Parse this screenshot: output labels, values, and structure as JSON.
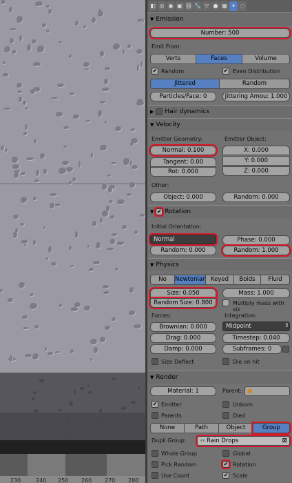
{
  "emission": {
    "title": "Emission",
    "number": "Number: 500",
    "emit_from_label": "Emit From:",
    "emit_from": [
      "Verts",
      "Faces",
      "Volume"
    ],
    "random": "Random",
    "even_distribution": "Even Distribution",
    "jitter_modes": [
      "Jittered",
      "Random"
    ],
    "particles_face": "Particles/Face: 0",
    "jittering_amount": "Jittering Amou: 1.000"
  },
  "hair": {
    "title": "Hair dynamics"
  },
  "velocity": {
    "title": "Velocity",
    "emitter_geometry_label": "Emitter Geometry:",
    "emitter_object_label": "Emitter Object:",
    "normal": "Normal: 0.100",
    "tangent": "Tangent: 0.00",
    "rot": "Rot: 0.000",
    "x": "X: 0.000",
    "y": "Y: 0.000",
    "z": "Z: 0.000",
    "other_label": "Other:",
    "object": "Object: 0.000",
    "random": "Random: 0.000"
  },
  "rotation": {
    "title": "Rotation",
    "initial_orientation_label": "Initial Orientation:",
    "orientation": "Normal",
    "random": "Random: 0.000",
    "phase": "Phase: 0.000",
    "phase_random": "Random: 1.000"
  },
  "physics": {
    "title": "Physics",
    "modes": [
      "No",
      "Newtonian",
      "Keyed",
      "Boids",
      "Fluid"
    ],
    "size": "Size: 0.050",
    "random_size": "Random Size: 0.800",
    "mass": "Mass: 1.000",
    "multiply_mass": "Multiply mass with siz",
    "forces_label": "Forces:",
    "integration_label": "Integration:",
    "brownian": "Brownian: 0.000",
    "drag": "Drag: 0.000",
    "damp": "Damp: 0.000",
    "integrator": "Midpoint",
    "timestep": "Timestep: 0.040",
    "subframes": "Subframes: 0",
    "size_deflect": "Size Deflect",
    "die_on_hit": "Die on hit"
  },
  "render": {
    "title": "Render",
    "material": "Material: 1",
    "parent": "Parent:",
    "emitter": "Emitter",
    "unborn": "Unborn",
    "parents": "Parents",
    "died": "Died",
    "types": [
      "None",
      "Path",
      "Object",
      "Group"
    ],
    "dupli_group_label": "Dupli Group:",
    "dupli_group": "Rain Drops",
    "whole_group": "Whole Group",
    "global": "Global",
    "pick_random": "Pick Random",
    "rotation": "Rotation",
    "use_count": "Use Count",
    "scale": "Scale"
  },
  "ruler": {
    "ticks": [
      "230",
      "240",
      "250",
      "260",
      "270",
      "280"
    ]
  },
  "colors": {
    "accent": "#5680c2",
    "highlight": "#d8192a",
    "panel": "#727272"
  }
}
